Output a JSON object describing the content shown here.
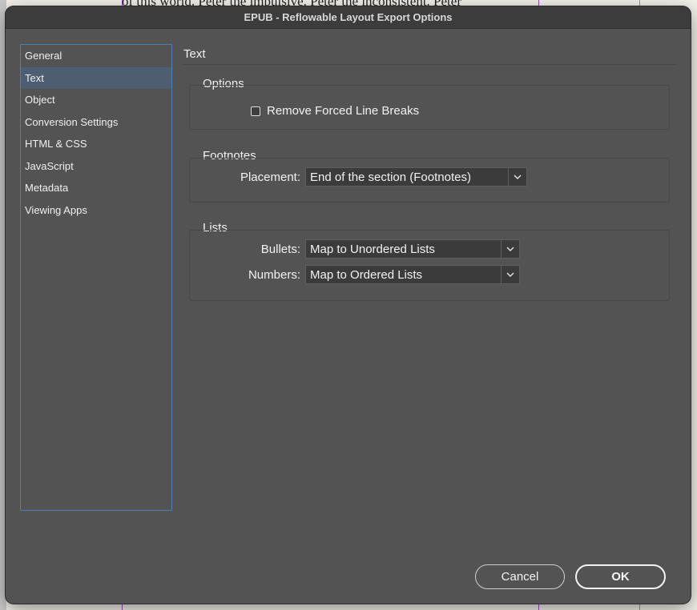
{
  "background": {
    "text": "of this world. Peter the impulsive. Peter the inconsistent. Peter"
  },
  "dialog": {
    "title": "EPUB - Reflowable Layout Export Options"
  },
  "nav": {
    "items": [
      {
        "label": "General"
      },
      {
        "label": "Text"
      },
      {
        "label": "Object"
      },
      {
        "label": "Conversion Settings"
      },
      {
        "label": "HTML & CSS"
      },
      {
        "label": "JavaScript"
      },
      {
        "label": "Metadata"
      },
      {
        "label": "Viewing Apps"
      }
    ],
    "selected": "Text"
  },
  "panel": {
    "title": "Text",
    "options": {
      "label": "Options",
      "remove_forced_line_breaks": {
        "label": "Remove Forced Line Breaks",
        "checked": false
      }
    },
    "footnotes": {
      "label": "Footnotes",
      "placement_label": "Placement:",
      "placement_value": "End of the section (Footnotes)"
    },
    "lists": {
      "label": "Lists",
      "bullets_label": "Bullets:",
      "bullets_value": "Map to Unordered Lists",
      "numbers_label": "Numbers:",
      "numbers_value": "Map to Ordered Lists"
    }
  },
  "buttons": {
    "cancel": "Cancel",
    "ok": "OK"
  },
  "icons": {
    "dropdown": "chevron-down-icon"
  },
  "colors": {
    "dialog_bg": "#535353",
    "selection": "#4d5d72",
    "nav_border": "#4c7fb8"
  }
}
